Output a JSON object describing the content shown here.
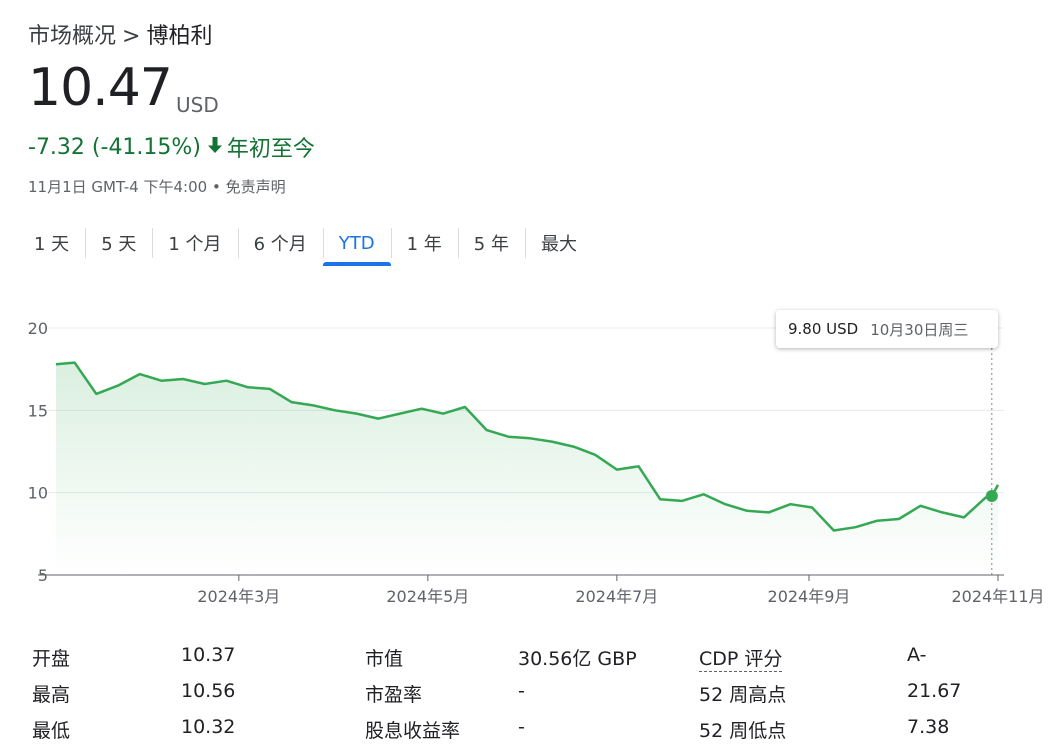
{
  "breadcrumb": {
    "parent": "市场概况",
    "separator": ">",
    "current": "博柏利"
  },
  "quote": {
    "price": "10.47",
    "currency": "USD",
    "change": "-7.32 (-41.15%)",
    "period": "年初至今",
    "timestamp": "11月1日 GMT-4 下午4:00",
    "disclaimer": "免责声明",
    "accent_color": "#137333"
  },
  "tabs": [
    {
      "label": "1 天",
      "active": false
    },
    {
      "label": "5 天",
      "active": false
    },
    {
      "label": "1 个月",
      "active": false
    },
    {
      "label": "6 个月",
      "active": false
    },
    {
      "label": "YTD",
      "active": true
    },
    {
      "label": "1 年",
      "active": false
    },
    {
      "label": "5 年",
      "active": false
    },
    {
      "label": "最大",
      "active": false
    }
  ],
  "tooltip": {
    "price": "9.80 USD",
    "date": "10月30日周三"
  },
  "chart_data": {
    "type": "area",
    "x": [
      "2024-01-02",
      "2024-01-08",
      "2024-01-15",
      "2024-01-22",
      "2024-01-29",
      "2024-02-05",
      "2024-02-12",
      "2024-02-19",
      "2024-02-26",
      "2024-03-04",
      "2024-03-11",
      "2024-03-18",
      "2024-03-25",
      "2024-04-01",
      "2024-04-08",
      "2024-04-15",
      "2024-04-22",
      "2024-04-29",
      "2024-05-06",
      "2024-05-13",
      "2024-05-20",
      "2024-05-27",
      "2024-06-03",
      "2024-06-10",
      "2024-06-17",
      "2024-06-24",
      "2024-07-01",
      "2024-07-08",
      "2024-07-15",
      "2024-07-22",
      "2024-07-29",
      "2024-08-05",
      "2024-08-12",
      "2024-08-19",
      "2024-08-26",
      "2024-09-02",
      "2024-09-09",
      "2024-09-16",
      "2024-09-23",
      "2024-09-30",
      "2024-10-07",
      "2024-10-14",
      "2024-10-21",
      "2024-10-28",
      "2024-10-30",
      "2024-11-01"
    ],
    "y": [
      17.8,
      17.9,
      16.0,
      16.5,
      17.2,
      16.8,
      16.9,
      16.6,
      16.8,
      16.4,
      16.3,
      15.5,
      15.3,
      15.0,
      14.8,
      14.5,
      14.8,
      15.1,
      14.8,
      15.2,
      13.8,
      13.4,
      13.3,
      13.1,
      12.8,
      12.3,
      11.4,
      11.6,
      9.6,
      9.5,
      9.9,
      9.3,
      8.9,
      8.8,
      9.3,
      9.1,
      7.7,
      7.9,
      8.3,
      8.4,
      9.2,
      8.8,
      8.5,
      9.7,
      9.8,
      10.47
    ],
    "ylim": [
      5,
      20
    ],
    "yticks": [
      5,
      10,
      15,
      20
    ],
    "xtick_labels": [
      {
        "label": "2024年3月",
        "date": "2024-03-01"
      },
      {
        "label": "2024年5月",
        "date": "2024-05-01"
      },
      {
        "label": "2024年7月",
        "date": "2024-07-01"
      },
      {
        "label": "2024年9月",
        "date": "2024-09-01"
      },
      {
        "label": "2024年11月",
        "date": "2024-11-01"
      }
    ],
    "highlight_date": "2024-10-30",
    "line_color": "#34a853",
    "grid": true
  },
  "stats": [
    {
      "label1": "开盘",
      "value1": "10.37",
      "label2": "市值",
      "value2": "30.56亿 GBP",
      "label3": "CDP 评分",
      "value3": "A-"
    },
    {
      "label1": "最高",
      "value1": "10.56",
      "label2": "市盈率",
      "value2": "-",
      "label3": "52 周高点",
      "value3": "21.67"
    },
    {
      "label1": "最低",
      "value1": "10.32",
      "label2": "股息收益率",
      "value2": "-",
      "label3": "52 周低点",
      "value3": "7.38"
    }
  ]
}
